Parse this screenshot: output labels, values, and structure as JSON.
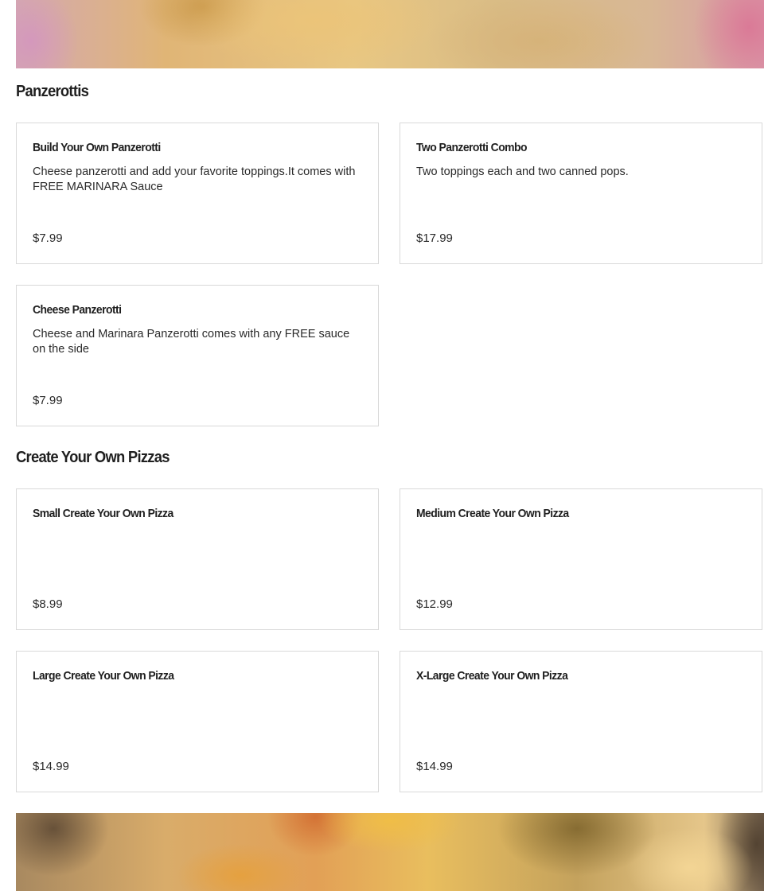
{
  "sections": [
    {
      "title": "Panzerottis",
      "items": [
        {
          "name": "Build Your Own Panzerotti",
          "description": "Cheese panzerotti and add your favorite toppings.It comes with FREE MARINARA Sauce",
          "price": "$7.99"
        },
        {
          "name": "Two Panzerotti Combo",
          "description": "Two toppings each and two canned pops.",
          "price": "$17.99"
        },
        {
          "name": "Cheese Panzerotti",
          "description": "Cheese and Marinara Panzerotti comes with any FREE sauce on the side",
          "price": "$7.99"
        }
      ]
    },
    {
      "title": "Create Your Own Pizzas",
      "items": [
        {
          "name": "Small Create Your Own Pizza",
          "description": "",
          "price": "$8.99"
        },
        {
          "name": "Medium Create Your Own Pizza",
          "description": "",
          "price": "$12.99"
        },
        {
          "name": "Large Create Your Own Pizza",
          "description": "",
          "price": "$14.99"
        },
        {
          "name": "X-Large Create Your Own Pizza",
          "description": "",
          "price": "$14.99"
        }
      ]
    }
  ]
}
